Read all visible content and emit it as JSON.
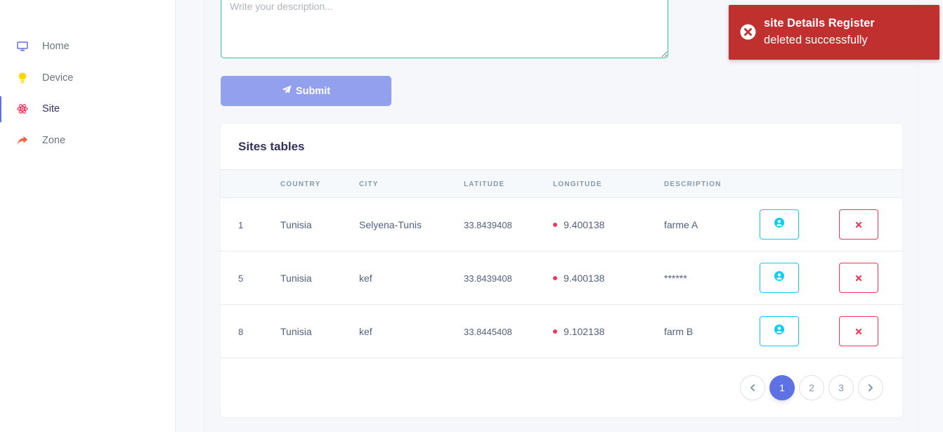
{
  "sidebar": {
    "items": [
      {
        "label": "Home",
        "icon": "monitor-icon"
      },
      {
        "label": "Device",
        "icon": "bulb-icon"
      },
      {
        "label": "Site",
        "icon": "atom-icon",
        "active": true
      },
      {
        "label": "Zone",
        "icon": "share-arrow-icon"
      }
    ]
  },
  "form": {
    "description_placeholder": "Write your description...",
    "submit_label": "Submit"
  },
  "table": {
    "title": "Sites tables",
    "headers": [
      "COUNTRY",
      "CITY",
      "LATITUDE",
      "LONGITUDE",
      "DESCRIPTION"
    ],
    "rows": [
      {
        "id": "1",
        "country": "Tunisia",
        "city": "Selyena-Tunis",
        "latitude": "33.8439408",
        "longitude": "9.400138",
        "description": "farme A"
      },
      {
        "id": "5",
        "country": "Tunisia",
        "city": "kef",
        "latitude": "33.8439408",
        "longitude": "9.400138",
        "description": "******"
      },
      {
        "id": "8",
        "country": "Tunisia",
        "city": "kef",
        "latitude": "33.8445408",
        "longitude": "9.102138",
        "description": "farm B"
      }
    ]
  },
  "pagination": {
    "prev_icon": "chevron-left-icon",
    "pages": [
      "1",
      "2",
      "3"
    ],
    "current": "1",
    "next_icon": "chevron-right-icon"
  },
  "toast": {
    "title": "site Details Register",
    "message": "deleted successfully",
    "icon": "error-circle-icon"
  },
  "colors": {
    "primary": "#5e72e4",
    "info": "#11cdef",
    "danger": "#f5365c",
    "toast_bg": "#c0302e",
    "longitude_dot": "#f5365c"
  }
}
